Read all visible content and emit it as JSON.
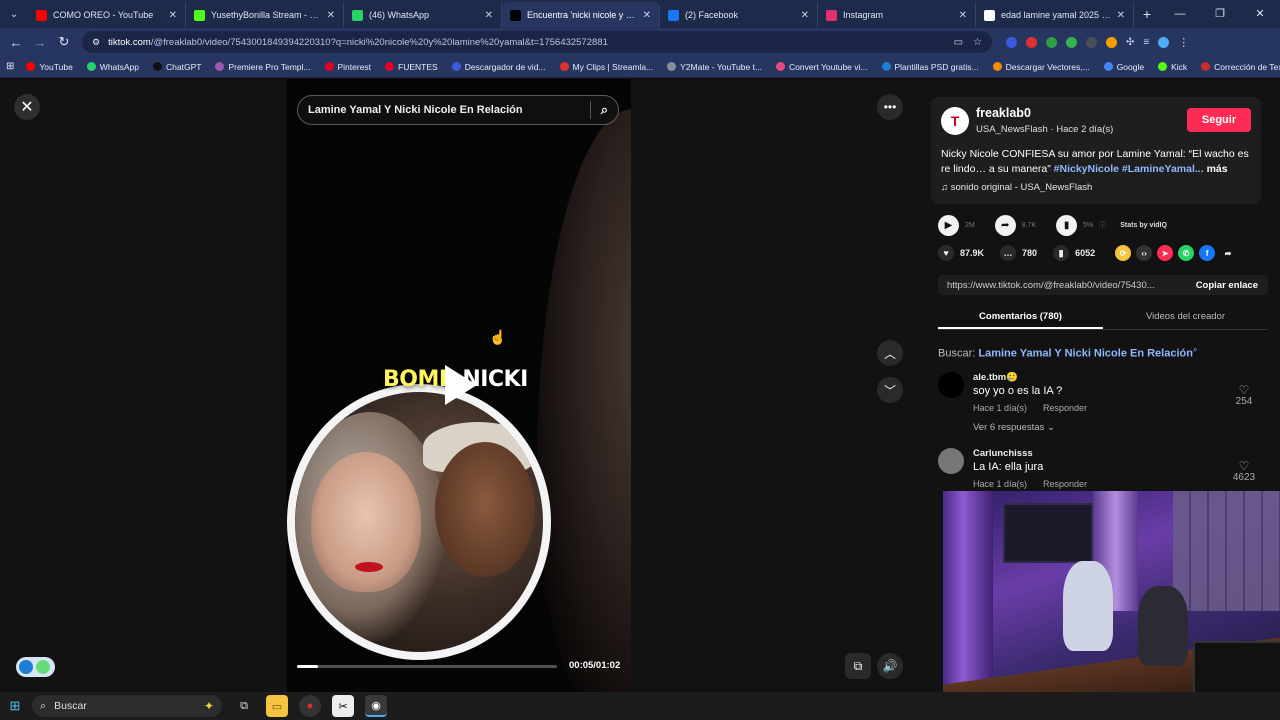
{
  "browser": {
    "tabs": [
      {
        "title": "COMO OREO - YouTube",
        "icon": "youtube-icon",
        "color": "#ff0000",
        "active": false
      },
      {
        "title": "YusethyBonilla Stream - Watch",
        "icon": "kick-icon",
        "color": "#53fc18",
        "active": false
      },
      {
        "title": "(46) WhatsApp",
        "icon": "whatsapp-icon",
        "color": "#25d366",
        "active": false
      },
      {
        "title": "Encuentra 'nicki nicole y lamine",
        "icon": "tiktok-icon",
        "color": "#000000",
        "active": true
      },
      {
        "title": "(2) Facebook",
        "icon": "facebook-icon",
        "color": "#1877f2",
        "active": false
      },
      {
        "title": "Instagram",
        "icon": "instagram-icon",
        "color": "#e1306c",
        "active": false
      },
      {
        "title": "edad lamine yamal 2025 - Busc",
        "icon": "google-icon",
        "color": "#ffffff",
        "active": false
      }
    ],
    "new_tab": "+",
    "url_host": "tiktok.com",
    "url_path": "/@freaklab0/video/7543001849394220310?q=nicki%20nicole%20y%20lamine%20yamal&t=1756432572881",
    "bookmarks": [
      {
        "label": "YouTube",
        "color": "#ff0000"
      },
      {
        "label": "WhatsApp",
        "color": "#25d366"
      },
      {
        "label": "ChatGPT",
        "color": "#111111"
      },
      {
        "label": "Premiere Pro Templ...",
        "color": "#9b59b6"
      },
      {
        "label": "Pinterest",
        "color": "#e60023"
      },
      {
        "label": "FUENTES",
        "color": "#e60023"
      },
      {
        "label": "Descargador de vid...",
        "color": "#3b5bdb"
      },
      {
        "label": "My Clips | Streamla...",
        "color": "#e03131"
      },
      {
        "label": "Y2Mate - YouTube t...",
        "color": "#868e96"
      },
      {
        "label": "Convert Youtube vi...",
        "color": "#e64980"
      },
      {
        "label": "Plantillas PSD gratis...",
        "color": "#1c7ed6"
      },
      {
        "label": "Descargar Vectores,...",
        "color": "#f08c00"
      },
      {
        "label": "Google",
        "color": "#4285f4"
      },
      {
        "label": "Kick",
        "color": "#53fc18"
      },
      {
        "label": "Corrección de Texto...",
        "color": "#c92a2a"
      }
    ]
  },
  "player": {
    "search_query": "Lamine Yamal Y Nicki Nicole En Relación",
    "overlay_text_yellow": "BOMB",
    "overlay_text_white": "NICKI",
    "time": "00:05/01:02",
    "progress": 0.081
  },
  "panel": {
    "username": "freaklab0",
    "display_name": "USA_NewsFlash",
    "posted": "Hace 2 día(s)",
    "follow_label": "Seguir",
    "caption": "Nicky Nicole CONFIESA su amor por Lamine Yamal: “El wacho es re lindo… a su manera”",
    "hashtags": "#NickyNicole #LamineYamal...",
    "more": "más",
    "sound": "sonido original - USA_NewsFlash",
    "row1": {
      "play_count": "2M",
      "share_count": "8.7K",
      "pct": "5%",
      "stats_label": "Stats by vidIQ"
    },
    "likes": "87.9K",
    "comments": "780",
    "saves": "6052",
    "link": "https://www.tiktok.com/@freaklab0/video/75430...",
    "copy_label": "Copiar enlace",
    "tab_comments": "Comentarios (780)",
    "tab_creator": "Videos del creador",
    "search_prefix": "Buscar:",
    "search_term": "Lamine Yamal Y Nicki Nicole En Relación",
    "comment_items": [
      {
        "user": "ale.tbm🥲",
        "text": "soy yo o es la IA ?",
        "time": "Hace 1 día(s)",
        "reply": "Responder",
        "likes": "254",
        "replies": "Ver 6 respuestas"
      },
      {
        "user": "Carlunchisss",
        "text": "La IA: ella jura",
        "time": "Hace 1 día(s)",
        "reply": "Responder",
        "likes": "4623"
      }
    ]
  },
  "taskbar": {
    "search_placeholder": "Buscar"
  }
}
